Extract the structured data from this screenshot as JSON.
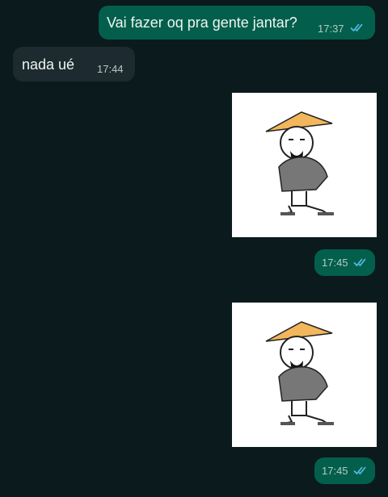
{
  "colors": {
    "outgoing_bubble": "#035f4b",
    "incoming_bubble": "#1d2a2f",
    "background": "#0b1a1c",
    "read_ticks": "#53bdeb"
  },
  "messages": [
    {
      "direction": "outgoing",
      "text": "Vai fazer oq pra gente jantar?",
      "time": "17:37",
      "status": "read"
    },
    {
      "direction": "incoming",
      "text": "nada ué",
      "time": "17:44"
    },
    {
      "direction": "outgoing",
      "type": "sticker",
      "sticker": "man-with-conical-hat-sticker"
    },
    {
      "direction": "outgoing",
      "time": "17:45",
      "status": "read"
    },
    {
      "direction": "outgoing",
      "type": "sticker",
      "sticker": "man-with-conical-hat-sticker"
    },
    {
      "direction": "outgoing",
      "time": "17:45",
      "status": "read"
    }
  ]
}
